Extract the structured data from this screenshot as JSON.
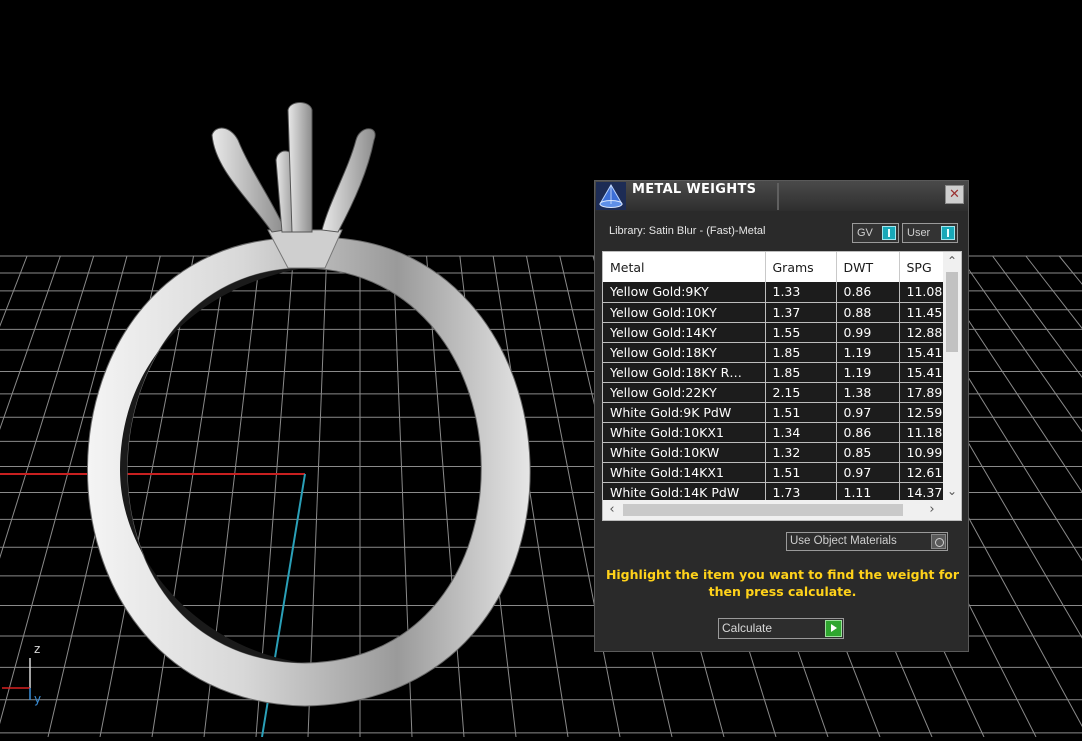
{
  "viewport": {
    "axis_labels": {
      "z": "z",
      "y": "y"
    }
  },
  "panel": {
    "title": "METAL WEIGHTS",
    "icon": "cone-app-icon",
    "close_icon": "close-icon",
    "library_label": "Library: Satin Blur - (Fast)-Metal",
    "gv_label": "GV",
    "user_label": "User",
    "table": {
      "headers": [
        "Metal",
        "Grams",
        "DWT",
        "SPG"
      ],
      "rows": [
        [
          "Yellow Gold:9KY",
          "1.33",
          "0.86",
          "11.08"
        ],
        [
          "Yellow Gold:10KY",
          "1.37",
          "0.88",
          "11.45"
        ],
        [
          "Yellow Gold:14KY",
          "1.55",
          "0.99",
          "12.88"
        ],
        [
          "Yellow Gold:18KY",
          "1.85",
          "1.19",
          "15.41"
        ],
        [
          "Yellow Gold:18KY R…",
          "1.85",
          "1.19",
          "15.41"
        ],
        [
          "Yellow Gold:22KY",
          "2.15",
          "1.38",
          "17.89"
        ],
        [
          "White Gold:9K PdW",
          "1.51",
          "0.97",
          "12.59"
        ],
        [
          "White Gold:10KX1",
          "1.34",
          "0.86",
          "11.18"
        ],
        [
          "White Gold:10KW",
          "1.32",
          "0.85",
          "10.99"
        ],
        [
          "White Gold:14KX1",
          "1.51",
          "0.97",
          "12.61"
        ],
        [
          "White Gold:14K PdW",
          "1.73",
          "1.11",
          "14.37"
        ]
      ]
    },
    "use_object_materials_label": "Use Object Materials",
    "instructions": "Highlight the item you want to find the weight for then press calculate.",
    "calculate_label": "Calculate",
    "colors": {
      "instruction_text": "#ffd21a",
      "toggle_knob": "#18a8b8",
      "calculate_accent": "#2fa62f"
    }
  }
}
